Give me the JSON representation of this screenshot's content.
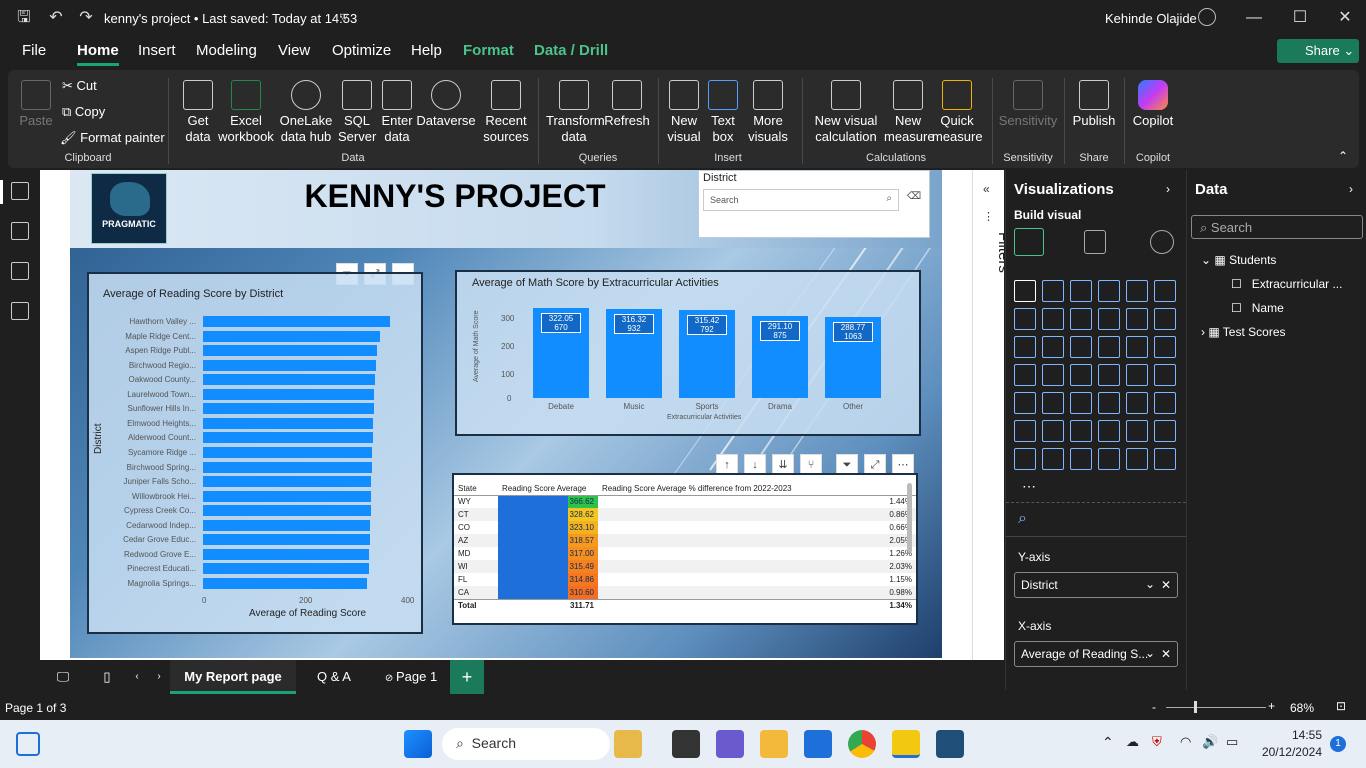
{
  "app": {
    "title": "kenny's project • Last saved: Today at 14:53",
    "user": "Kehinde Olajide"
  },
  "menu": [
    "File",
    "Home",
    "Insert",
    "Modeling",
    "View",
    "Optimize",
    "Help",
    "Format",
    "Data / Drill"
  ],
  "share_label": "Share",
  "ribbon": {
    "clipboard": {
      "paste": "Paste",
      "cut": "Cut",
      "copy": "Copy",
      "format_painter": "Format painter",
      "group": "Clipboard"
    },
    "data": {
      "items": [
        "Get\ndata",
        "Excel\nworkbook",
        "OneLake\ndata hub",
        "SQL\nServer",
        "Enter\ndata",
        "Dataverse",
        "Recent\nsources"
      ],
      "group": "Data"
    },
    "queries": {
      "items": [
        "Transform\ndata",
        "Refresh"
      ],
      "group": "Queries"
    },
    "insert": {
      "items": [
        "New\nvisual",
        "Text\nbox",
        "More\nvisuals"
      ],
      "group": "Insert"
    },
    "calculations": {
      "items": [
        "New visual\ncalculation",
        "New\nmeasure",
        "Quick\nmeasure"
      ],
      "group": "Calculations"
    },
    "sensitivity": {
      "item": "Sensitivity",
      "group": "Sensitivity"
    },
    "share": {
      "item": "Publish",
      "group": "Share"
    },
    "copilot": {
      "item": "Copilot",
      "group": "Copilot"
    }
  },
  "report": {
    "title": "KENNY'S PROJECT",
    "logo_text": "PRAGMATIC",
    "slicer": {
      "title": "District",
      "placeholder": "Search"
    }
  },
  "reading_chart": {
    "title": "Average of Reading Score by District",
    "xlabel": "Average of Reading Score",
    "ylabel": "District",
    "ticks": [
      "0",
      "200",
      "400"
    ]
  },
  "math_chart": {
    "title": "Average of Math Score by Extracurricular Activities",
    "xlabel": "Extracurricular Activities",
    "ylabel": "Average of Math Score",
    "yticks": [
      "300",
      "200",
      "100",
      "0"
    ]
  },
  "table": {
    "headers": [
      "State",
      "Reading Score Average",
      "Reading Score Average % difference from 2022-2023"
    ],
    "rows": [
      [
        "WY",
        "366.62",
        "1.44%"
      ],
      [
        "CT",
        "328.62",
        "0.86%"
      ],
      [
        "CO",
        "323.10",
        "0.66%"
      ],
      [
        "AZ",
        "318.57",
        "2.05%"
      ],
      [
        "MD",
        "317.00",
        "1.26%"
      ],
      [
        "WI",
        "315.49",
        "2.03%"
      ],
      [
        "FL",
        "314.86",
        "1.15%"
      ],
      [
        "CA",
        "310.60",
        "0.98%"
      ]
    ],
    "total": [
      "Total",
      "311.71",
      "1.34%"
    ]
  },
  "filters_label": "Filters",
  "viz_pane": {
    "title": "Visualizations",
    "build": "Build visual",
    "y_axis": "Y-axis",
    "y_field": "District",
    "x_axis": "X-axis",
    "x_field": "Average of Reading S..."
  },
  "data_pane": {
    "title": "Data",
    "search": "Search",
    "tables": [
      "Students",
      "Extracurricular ...",
      "Name",
      "Test Scores"
    ]
  },
  "tabs": [
    "My Report page",
    "Q & A",
    "Page 1"
  ],
  "status": {
    "page": "Page 1 of 3",
    "zoom": "68%"
  },
  "taskbar": {
    "search": "Search",
    "time": "14:55",
    "date": "20/12/2024",
    "badge": "1"
  },
  "chart_data": [
    {
      "type": "bar",
      "title": "Average of Reading Score by District",
      "xlabel": "Average of Reading Score",
      "ylabel": "District",
      "xlim": [
        0,
        400
      ],
      "categories": [
        "Hawthorn Valley ...",
        "Maple Ridge Cent...",
        "Aspen Ridge Publ...",
        "Birchwood Regio...",
        "Oakwood County...",
        "Laurelwood Town...",
        "Sunflower Hills In...",
        "Elmwood Heights...",
        "Alderwood Count...",
        "Sycamore Ridge ...",
        "Birchwood Spring...",
        "Juniper Falls Scho...",
        "Willowbrook Hei...",
        "Cypress Creek Co...",
        "Cedarwood Indep...",
        "Cedar Grove Educ...",
        "Redwood Grove E...",
        "Pinecrest Educati...",
        "Magnolia Springs..."
      ],
      "values": [
        366,
        348,
        342,
        340,
        338,
        336,
        335,
        334,
        333,
        332,
        331,
        330,
        330,
        329,
        328,
        327,
        326,
        325,
        322
      ]
    },
    {
      "type": "bar",
      "title": "Average of Math Score by Extracurricular Activities",
      "xlabel": "Extracurricular Activities",
      "ylabel": "Average of Math Score",
      "ylim": [
        0,
        300
      ],
      "categories": [
        "Debate",
        "Music",
        "Sports",
        "Drama",
        "Other"
      ],
      "values": [
        322.05,
        316.32,
        315.42,
        291.1,
        288.77
      ],
      "counts": [
        "670",
        "932",
        "792",
        "875",
        "1063"
      ],
      "labels": [
        "322.05",
        "316.32",
        "315.42",
        "291.10",
        "288.77"
      ]
    }
  ]
}
